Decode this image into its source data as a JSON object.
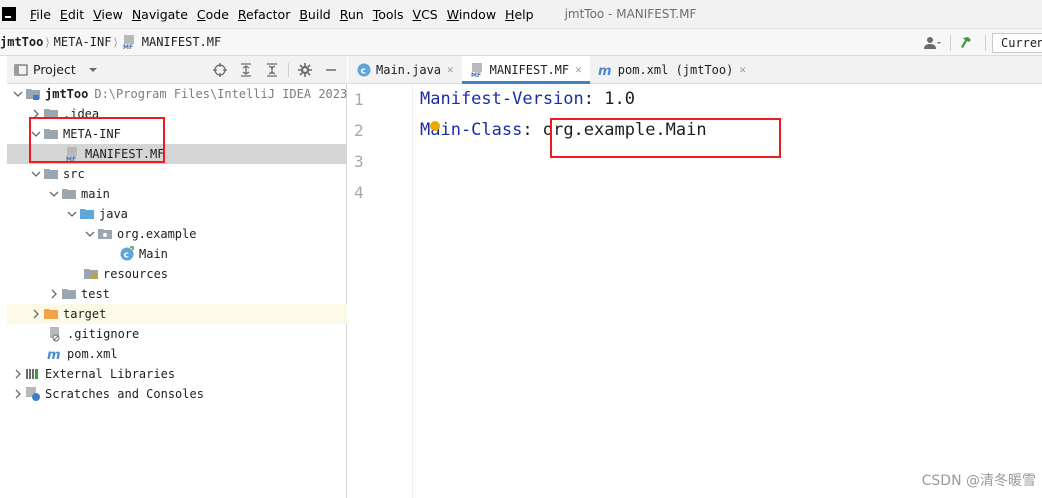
{
  "menu": {
    "items": [
      "File",
      "Edit",
      "View",
      "Navigate",
      "Code",
      "Refactor",
      "Build",
      "Run",
      "Tools",
      "VCS",
      "Window",
      "Help"
    ],
    "window_title": "jmtToo - MANIFEST.MF"
  },
  "navbar": {
    "crumbs": [
      "jmtToo",
      "META-INF",
      "MANIFEST.MF"
    ],
    "run_config": "Curren"
  },
  "project": {
    "title": "Project",
    "tree": [
      {
        "label": "jmtToo",
        "hint": "D:\\Program Files\\IntelliJ IDEA 2023",
        "icon": "module-folder-icon"
      },
      {
        "label": ".idea",
        "icon": "folder-icon"
      },
      {
        "label": "META-INF",
        "icon": "folder-icon"
      },
      {
        "label": "MANIFEST.MF",
        "icon": "manifest-file-icon"
      },
      {
        "label": "src",
        "icon": "folder-icon"
      },
      {
        "label": "main",
        "icon": "folder-icon"
      },
      {
        "label": "java",
        "icon": "source-folder-icon"
      },
      {
        "label": "org.example",
        "icon": "package-icon"
      },
      {
        "label": "Main",
        "icon": "java-class-icon"
      },
      {
        "label": "resources",
        "icon": "resources-folder-icon"
      },
      {
        "label": "test",
        "icon": "folder-icon"
      },
      {
        "label": "target",
        "icon": "excluded-folder-icon"
      },
      {
        "label": ".gitignore",
        "icon": "ignored-file-icon"
      },
      {
        "label": "pom.xml",
        "icon": "maven-icon"
      },
      {
        "label": "External Libraries",
        "icon": "libraries-icon"
      },
      {
        "label": "Scratches and Consoles",
        "icon": "scratches-icon"
      }
    ]
  },
  "editor": {
    "tabs": [
      {
        "label": "Main.java",
        "icon": "java-class-icon"
      },
      {
        "label": "MANIFEST.MF",
        "icon": "manifest-file-icon"
      },
      {
        "label": "pom.xml (jmtToo)",
        "icon": "maven-icon"
      }
    ],
    "active_tab": 1,
    "line_numbers": [
      "1",
      "2",
      "3",
      "4"
    ],
    "lines": [
      {
        "key": "Manifest-Version",
        "sep": ": ",
        "value": "1.0"
      },
      {
        "key": "Main-Class",
        "sep": ": ",
        "value": "org.example.Main"
      }
    ]
  },
  "watermark": "CSDN @清冬暖雪",
  "colors": {
    "accent": "#4083c9",
    "highlight_box": "#ee1c1c",
    "manifest_key": "#1a2ea6",
    "selection": "#d5d5d5"
  }
}
